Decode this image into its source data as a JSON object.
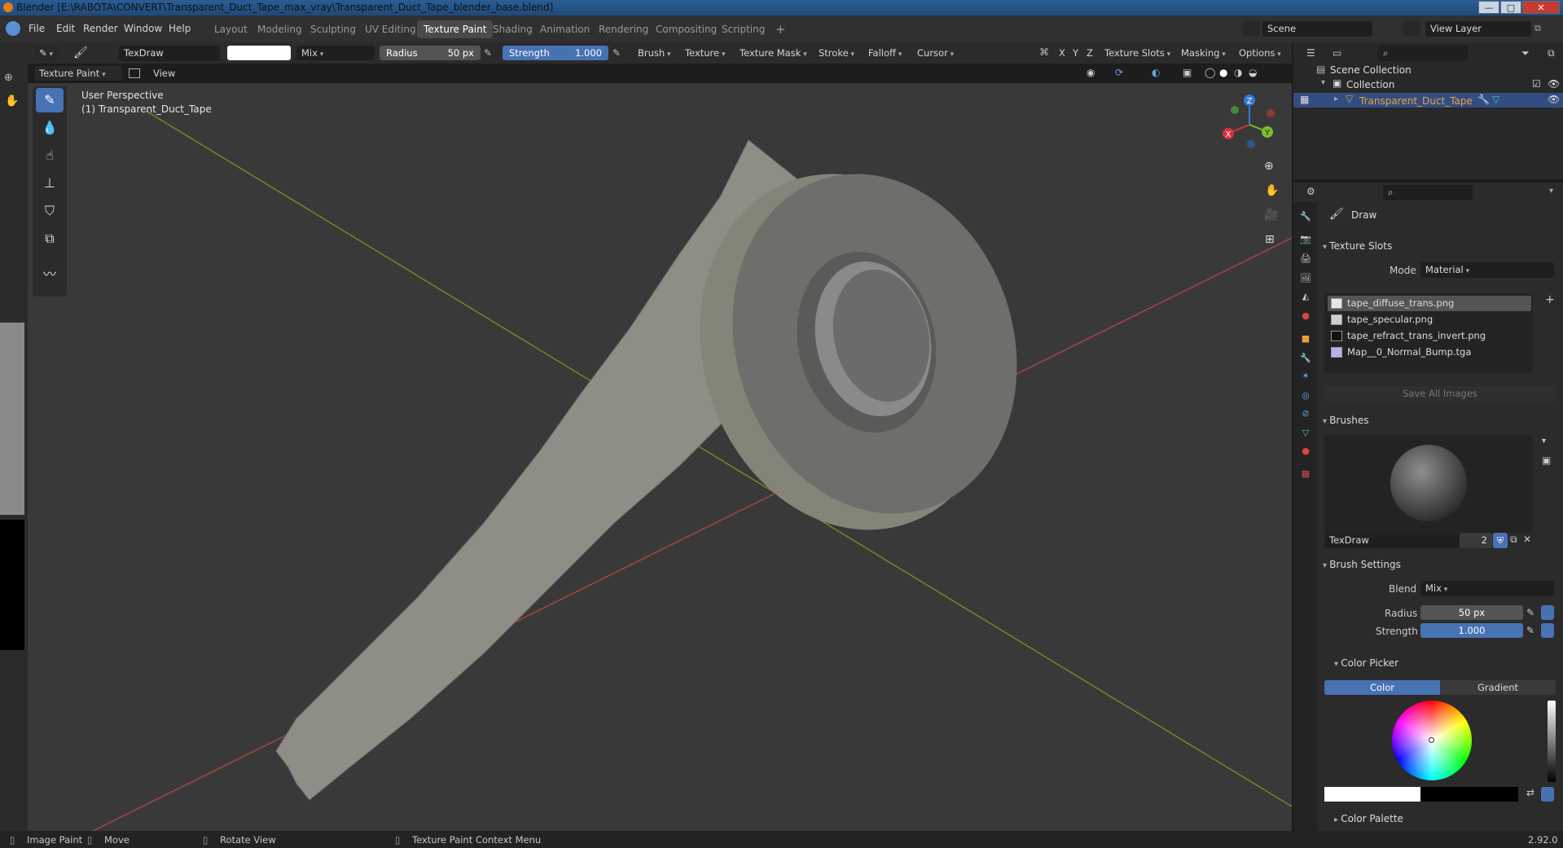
{
  "window": {
    "title": "Blender [E:\\RABOTA\\CONVERT\\Transparent_Duct_Tape_max_vray\\Transparent_Duct_Tape_blender_base.blend]",
    "minimize": "—",
    "maximize": "□",
    "close": "✕"
  },
  "menu": {
    "items": [
      "File",
      "Edit",
      "Render",
      "Window",
      "Help"
    ]
  },
  "workspaces": [
    "Layout",
    "Modeling",
    "Sculpting",
    "UV Editing",
    "Texture Paint",
    "Shading",
    "Animation",
    "Rendering",
    "Compositing",
    "Scripting",
    "+"
  ],
  "active_workspace": "Texture Paint",
  "scene": {
    "label": "Scene",
    "view_layer": "View Layer"
  },
  "tool_header": {
    "brush_name": "TexDraw",
    "blend": "Mix",
    "radius_label": "Radius",
    "radius_value": "50 px",
    "strength_label": "Strength",
    "strength_value": "1.000",
    "menus": [
      "Brush",
      "Texture",
      "Texture Mask",
      "Stroke",
      "Falloff",
      "Cursor"
    ],
    "axes": [
      "X",
      "Y",
      "Z"
    ],
    "right_menus": [
      "Texture Slots",
      "Masking",
      "Options"
    ]
  },
  "viewport_header": {
    "mode": "Texture Paint",
    "view": "View"
  },
  "viewport": {
    "info_line1": "User Perspective",
    "info_line2": "(1) Transparent_Duct_Tape",
    "gizmo": {
      "x": "X",
      "y": "Y",
      "z": "Z"
    }
  },
  "outliner": {
    "scene_collection": "Scene Collection",
    "collection": "Collection",
    "object": "Transparent_Duct_Tape"
  },
  "properties": {
    "tool_name": "Draw",
    "texture_slots": {
      "header": "Texture Slots",
      "mode_label": "Mode",
      "mode_value": "Material",
      "slots": [
        "tape_diffuse_trans.png",
        "tape_specular.png",
        "tape_refract_trans_invert.png",
        "Map__0_Normal_Bump.tga"
      ],
      "save_all": "Save All Images"
    },
    "brushes": {
      "header": "Brushes",
      "brush_name": "TexDraw",
      "users": "2"
    },
    "brush_settings": {
      "header": "Brush Settings",
      "blend_label": "Blend",
      "blend_value": "Mix",
      "radius_label": "Radius",
      "radius_value": "50 px",
      "strength_label": "Strength",
      "strength_value": "1.000"
    },
    "color_picker": {
      "header": "Color Picker",
      "tab_color": "Color",
      "tab_gradient": "Gradient"
    },
    "color_palette": "Color Palette"
  },
  "statusbar": {
    "left1": "Image Paint",
    "left2": "Move",
    "left3": "Rotate View",
    "left4": "Texture Paint Context Menu",
    "version": "2.92.0"
  },
  "colors": {
    "accent": "#4772b3",
    "selected_object": "#e8a040",
    "grid_x": "#b34a4a",
    "grid_y": "#7a9a35"
  }
}
